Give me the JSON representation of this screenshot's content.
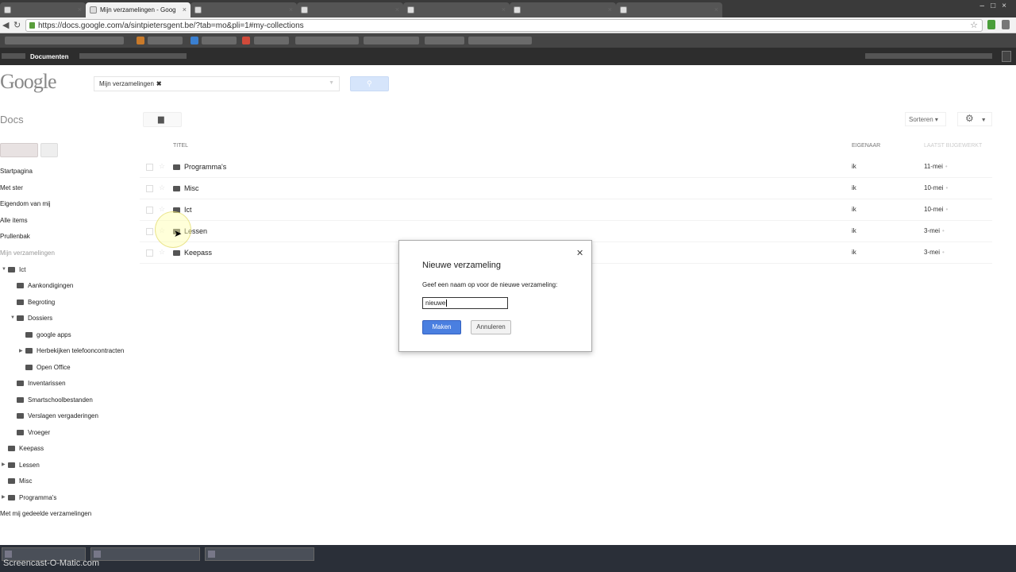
{
  "browser": {
    "tabs": [
      {
        "label": "",
        "active": false
      },
      {
        "label": "Mijn verzamelingen - Goog",
        "active": true
      },
      {
        "label": "",
        "active": false
      },
      {
        "label": "",
        "active": false
      },
      {
        "label": "",
        "active": false
      },
      {
        "label": "",
        "active": false
      },
      {
        "label": "",
        "active": false
      }
    ],
    "url": "https://docs.google.com/a/sintpietersgent.be/?tab=mo&pli=1#my-collections"
  },
  "gbar": {
    "selected": "Documenten"
  },
  "header": {
    "logo": "Google",
    "search_chip": "Mijn verzamelingen",
    "chip_remove": "✖",
    "docs_label": "Docs",
    "sort_label": "Sorteren ▾"
  },
  "sidebar": {
    "nav": [
      "Startpagina",
      "Met ster",
      "Eigendom van mij",
      "Alle items",
      "Prullenbak"
    ],
    "collections_header": "Mijn verzamelingen",
    "tree": [
      {
        "label": "Ict",
        "level": 0
      },
      {
        "label": "Aankondigingen",
        "level": 1
      },
      {
        "label": "Begroting",
        "level": 1
      },
      {
        "label": "Dossiers",
        "level": 1
      },
      {
        "label": "google apps",
        "level": 2
      },
      {
        "label": "Herbekijken telefooncontracten",
        "level": 2
      },
      {
        "label": "Open Office",
        "level": 2
      },
      {
        "label": "Inventarissen",
        "level": 1
      },
      {
        "label": "Smartschoolbestanden",
        "level": 1
      },
      {
        "label": "Verslagen vergaderingen",
        "level": 1
      },
      {
        "label": "Vroeger",
        "level": 1
      },
      {
        "label": "Keepass",
        "level": 0
      },
      {
        "label": "Lessen",
        "level": 0
      },
      {
        "label": "Misc",
        "level": 0
      },
      {
        "label": "Programma's",
        "level": 0
      }
    ],
    "shared": "Met mij gedeelde verzamelingen"
  },
  "table": {
    "headers": {
      "title": "Titel",
      "owner": "Eigenaar",
      "modified": "Laatst bijgewerkt"
    },
    "rows": [
      {
        "title": "Programma's",
        "owner": "ik",
        "date": "11-mei"
      },
      {
        "title": "Misc",
        "owner": "ik",
        "date": "10-mei"
      },
      {
        "title": "Ict",
        "owner": "ik",
        "date": "10-mei"
      },
      {
        "title": "Lessen",
        "owner": "ik",
        "date": "3-mei"
      },
      {
        "title": "Keepass",
        "owner": "ik",
        "date": "3-mei"
      }
    ]
  },
  "dialog": {
    "title": "Nieuwe verzameling",
    "prompt": "Geef een naam op voor de nieuwe verzameling:",
    "input_value": "nieuwe",
    "make_label": "Maken",
    "cancel_label": "Annuleren",
    "close": "✕"
  },
  "taskbar": {
    "watermark": "Screencast-O-Matic.com"
  }
}
